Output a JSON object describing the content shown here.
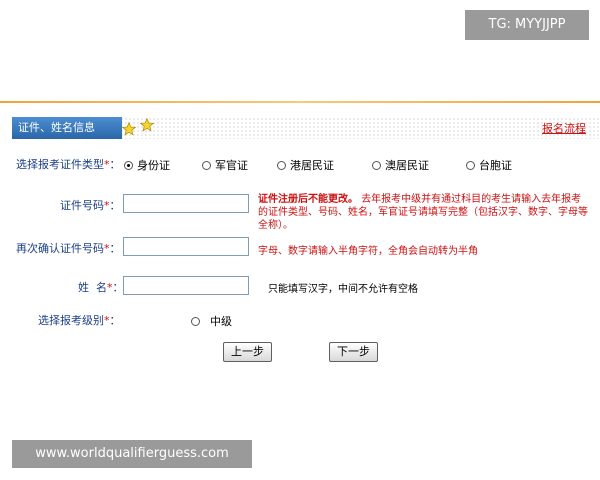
{
  "watermark": {
    "top_right": "TG: MYYJJPP",
    "bottom_left": "www.worldqualifierguess.com"
  },
  "tab": {
    "label": "证件、姓名信息",
    "process_link": "报名流程"
  },
  "form": {
    "id_type": {
      "label": "选择报考证件类型",
      "required_mark": "*",
      "colon": "：",
      "options": [
        {
          "label": "身份证",
          "checked": true
        },
        {
          "label": "军官证",
          "checked": false
        },
        {
          "label": "港居民证",
          "checked": false
        },
        {
          "label": "澳居民证",
          "checked": false
        },
        {
          "label": "台胞证",
          "checked": false
        }
      ]
    },
    "id_number": {
      "label": "证件号码",
      "required_mark": "*",
      "colon": "：",
      "value": ""
    },
    "id_note": {
      "bold": "证件注册后不能更改。",
      "text": "去年报考中级并有通过科目的考生请输入去年报考的证件类型、号码、姓名，军官证号请填写完整（包括汉字、数字、字母等全称）。"
    },
    "confirm_id": {
      "label": "再次确认证件号码",
      "required_mark": "*",
      "colon": "：",
      "value": ""
    },
    "confirm_note": "字母、数字请输入半角字符，全角会自动转为半角",
    "name": {
      "label": "姓  名",
      "required_mark": "*",
      "colon": "：",
      "value": ""
    },
    "name_note": "只能填写汉字，中间不允许有空格",
    "level": {
      "label": "选择报考级别",
      "required_mark": "*",
      "colon": "：",
      "options": [
        {
          "label": "中级",
          "checked": false
        }
      ]
    }
  },
  "buttons": {
    "prev": "上一步",
    "next": "下一步"
  },
  "colors": {
    "label_blue": "#1b3e8a",
    "required_red": "#cc1111",
    "tab_blue": "#2a66a8",
    "rule_orange": "#f2a23a"
  }
}
